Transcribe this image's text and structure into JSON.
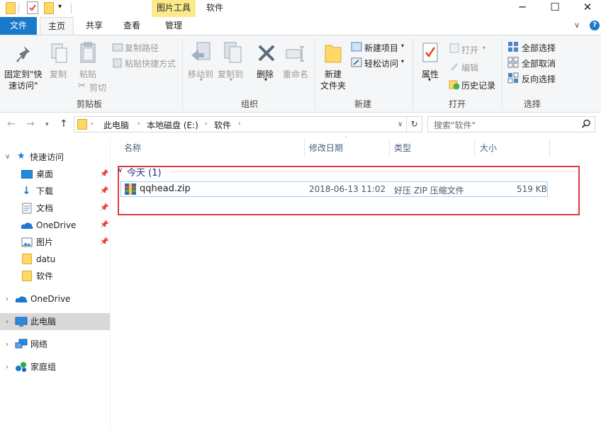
{
  "titlebar": {
    "context_tab": "图片工具",
    "title": "软件",
    "minimize": "─",
    "maximize": "☐",
    "close": "✕"
  },
  "tabs": {
    "file": "文件",
    "home": "主页",
    "share": "共享",
    "view": "查看",
    "manage": "管理",
    "help_chevron": "∨",
    "help_icon": "?"
  },
  "ribbon": {
    "clipboard": {
      "pin_line1": "固定到\"快",
      "pin_line2": "速访问\"",
      "copy": "复制",
      "paste": "粘贴",
      "copy_path": "复制路径",
      "paste_shortcut": "粘贴快捷方式",
      "cut": "剪切",
      "label": "剪贴板"
    },
    "organize": {
      "move_to": "移动到",
      "copy_to": "复制到",
      "delete": "删除",
      "rename": "重命名",
      "label": "组织"
    },
    "new": {
      "new_folder_line1": "新建",
      "new_folder_line2": "文件夹",
      "new_item": "新建项目",
      "easy_access": "轻松访问",
      "label": "新建"
    },
    "open": {
      "properties": "属性",
      "open": "打开",
      "edit": "编辑",
      "history": "历史记录",
      "label": "打开"
    },
    "select": {
      "select_all": "全部选择",
      "select_none": "全部取消",
      "invert": "反向选择",
      "label": "选择"
    }
  },
  "address": {
    "crumbs": [
      "此电脑",
      "本地磁盘 (E:)",
      "软件"
    ],
    "search_placeholder": "搜索\"软件\""
  },
  "navpane": {
    "quick_access": "快速访问",
    "items": [
      "桌面",
      "下载",
      "文档",
      "OneDrive",
      "图片",
      "datu",
      "软件"
    ],
    "onedrive": "OneDrive",
    "this_pc": "此电脑",
    "network": "网络",
    "homegroup": "家庭组"
  },
  "columns": {
    "name": "名称",
    "modified": "修改日期",
    "type": "类型",
    "size": "大小"
  },
  "group": {
    "header": "今天 (1)"
  },
  "files": [
    {
      "name": "qqhead.zip",
      "modified": "2018-06-13 11:02",
      "type": "好压 ZIP 压缩文件",
      "size": "519 KB"
    }
  ],
  "colors": {
    "file_tab": "#1979ca",
    "context_tab": "#fce98b",
    "highlight_box": "#e0393e",
    "selection_border": "#99d1ff"
  }
}
